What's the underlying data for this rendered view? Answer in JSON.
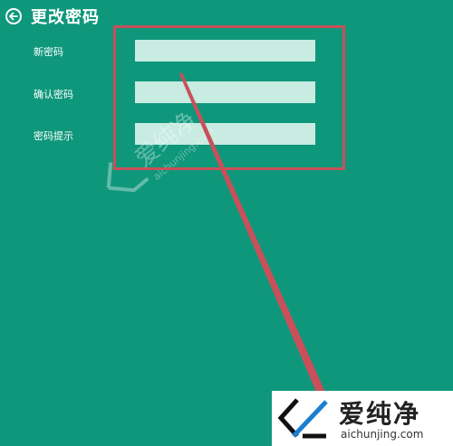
{
  "header": {
    "back_icon": "arrow-left-circle-icon",
    "title": "更改密码"
  },
  "form": {
    "fields": [
      {
        "label": "新密码",
        "value": ""
      },
      {
        "label": "确认密码",
        "value": ""
      },
      {
        "label": "密码提示",
        "value": ""
      }
    ]
  },
  "watermark": {
    "center_text": "爱纯净",
    "center_url": "aichunjing.com",
    "logo_text": "爱纯净",
    "logo_url": "aichunjing.com"
  },
  "colors": {
    "background": "#0f977b",
    "field": "#c8ebe2",
    "annotation": "#c9505a"
  }
}
